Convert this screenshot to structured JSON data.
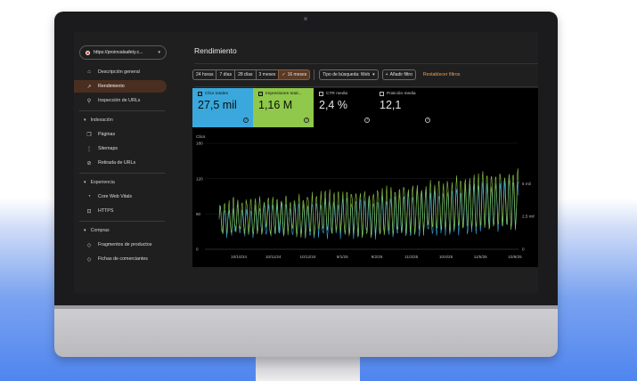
{
  "property": {
    "url": "https://proinvalsafety.c...",
    "caret": "▾"
  },
  "sidebar": {
    "items": [
      {
        "label": "Descripción general",
        "icon": "⌂"
      },
      {
        "label": "Rendimiento",
        "icon": "↗"
      },
      {
        "label": "Inspección de URLs",
        "icon": "⚲"
      }
    ],
    "sections": [
      {
        "title": "Indexación",
        "items": [
          {
            "label": "Páginas",
            "icon": "❐"
          },
          {
            "label": "Sitemaps",
            "icon": "⋮"
          },
          {
            "label": "Retirada de URLs",
            "icon": "⊘"
          }
        ]
      },
      {
        "title": "Experiencia",
        "items": [
          {
            "label": "Core Web Vitals",
            "icon": "◔"
          },
          {
            "label": "HTTPS",
            "icon": "⊡"
          }
        ]
      },
      {
        "title": "Compras",
        "items": [
          {
            "label": "Fragmentos de productos",
            "icon": "◇"
          },
          {
            "label": "Fichas de comerciantes",
            "icon": "◇"
          }
        ]
      }
    ]
  },
  "page": {
    "title": "Rendimiento"
  },
  "filters": {
    "ranges": [
      "24 horas",
      "7 días",
      "28 días",
      "3 meses"
    ],
    "selected_range": "16 meses",
    "search_type": "Tipo de búsqueda: Web",
    "add_filter": "Añadir filtro",
    "reset": "Restablecer filtros"
  },
  "metrics": [
    {
      "label": "Clics totales",
      "value": "27,5 mil",
      "checked": true,
      "color": "#3aa8dc"
    },
    {
      "label": "Impresiones total...",
      "value": "1,16 M",
      "checked": true,
      "color": "#8fc84a"
    },
    {
      "label": "CTR medio",
      "value": "2,4 %",
      "checked": false
    },
    {
      "label": "Posición media",
      "value": "12,1",
      "checked": false
    }
  ],
  "chart_data": {
    "type": "line",
    "left_axis": {
      "title": "Clics",
      "ticks": [
        "180",
        "120",
        "60",
        "0"
      ]
    },
    "right_axis": {
      "ticks": [
        "5 mil",
        "2,5 mil",
        "0"
      ]
    },
    "x_ticks": [
      "10/10/24",
      "10/11/24",
      "10/12/24",
      "9/1/25",
      "9/2/25",
      "11/3/25",
      "10/4/25",
      "11/5/25",
      "10/6/25"
    ],
    "series": [
      {
        "values_note": "",
        "color": "#8fc84a"
      },
      {
        "color": "#3aa8dc"
      }
    ],
    "ylim": [
      0,
      180
    ]
  }
}
